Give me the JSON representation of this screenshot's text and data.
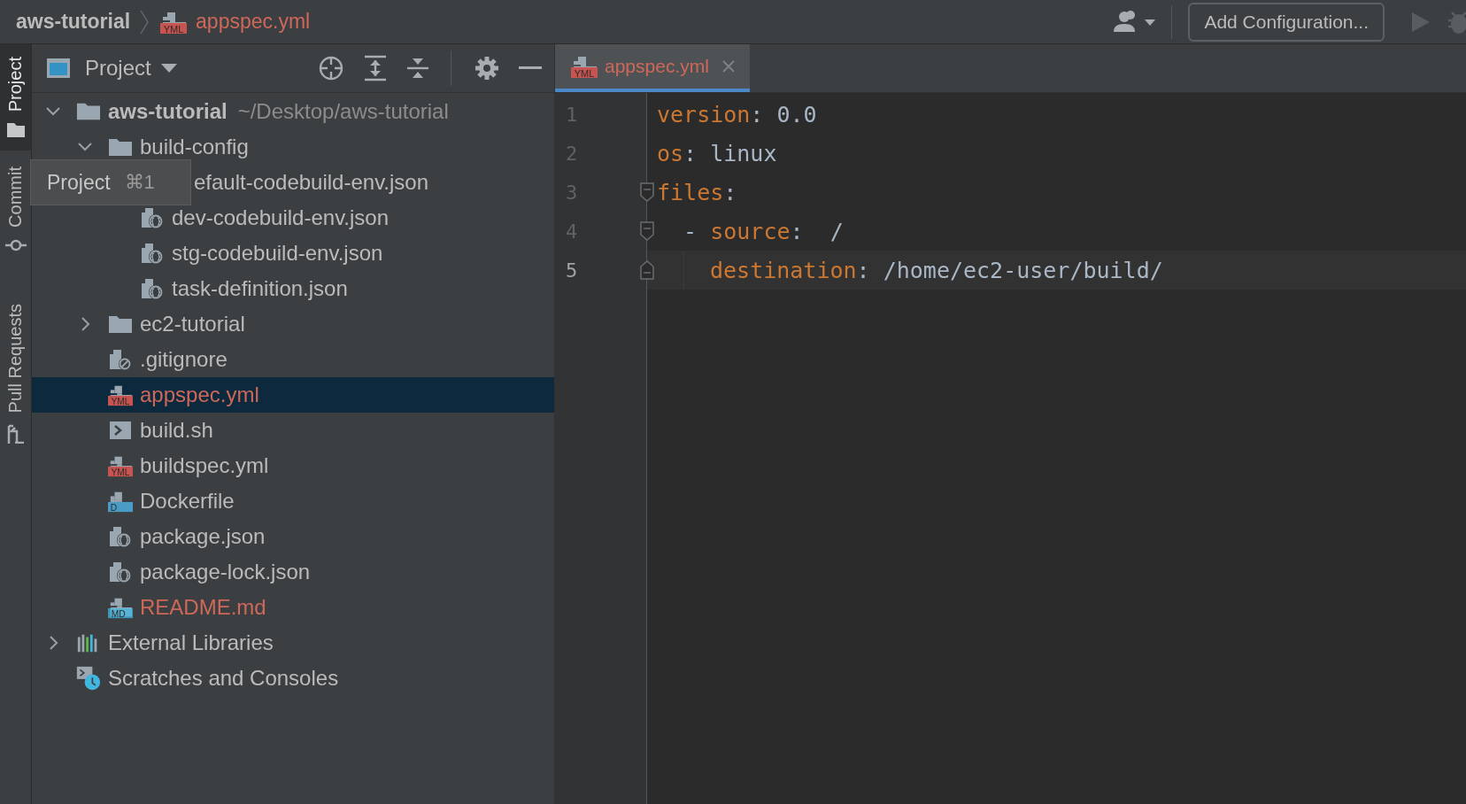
{
  "breadcrumb": [
    {
      "label": "aws-tutorial",
      "kind": "project"
    },
    {
      "label": "appspec.yml",
      "kind": "yml",
      "badge": "YML",
      "color": "#d0685a"
    }
  ],
  "toolbar": {
    "run_config": "Add Configuration..."
  },
  "tool_windows": [
    {
      "label": "Project",
      "kind": "project",
      "selected": true
    },
    {
      "label": "Commit",
      "kind": "commit",
      "selected": false
    },
    {
      "label": "Pull Requests",
      "kind": "pulls",
      "selected": false
    }
  ],
  "project_panel": {
    "title": "Project"
  },
  "tooltip": {
    "text": "Project",
    "shortcut": "⌘1"
  },
  "tree": [
    {
      "label": "aws-tutorial",
      "path": "~/Desktop/aws-tutorial",
      "kind": "module",
      "expanded": true,
      "selected": false,
      "children": [
        {
          "label": "build-config",
          "kind": "folder",
          "expanded": true,
          "selected": false,
          "children": [
            {
              "label": "efault-codebuild-env.json",
              "kind": "covered",
              "selected": false
            },
            {
              "label": "dev-codebuild-env.json",
              "kind": "json",
              "selected": false
            },
            {
              "label": "stg-codebuild-env.json",
              "kind": "json",
              "selected": false
            },
            {
              "label": "task-definition.json",
              "kind": "json",
              "selected": false
            }
          ]
        },
        {
          "label": "ec2-tutorial",
          "kind": "folder",
          "expanded": false,
          "selected": false
        },
        {
          "label": ".gitignore",
          "kind": "ignore",
          "selected": false
        },
        {
          "label": "appspec.yml",
          "kind": "yml",
          "badge": "YML",
          "color": "#d0685a",
          "selected": true
        },
        {
          "label": "build.sh",
          "kind": "shell",
          "selected": false
        },
        {
          "label": "buildspec.yml",
          "kind": "yml",
          "badge": "YML",
          "selected": false
        },
        {
          "label": "Dockerfile",
          "kind": "docker",
          "badge": "D",
          "selected": false
        },
        {
          "label": "package.json",
          "kind": "json",
          "selected": false
        },
        {
          "label": "package-lock.json",
          "kind": "json",
          "selected": false
        },
        {
          "label": "README.md",
          "kind": "md",
          "badge": "MD",
          "color": "#d0685a",
          "selected": false
        }
      ]
    },
    {
      "label": "External Libraries",
      "kind": "libraries",
      "expanded": false,
      "selected": false
    },
    {
      "label": "Scratches and Consoles",
      "kind": "scratches",
      "selected": false
    }
  ],
  "editor": {
    "tabs": [
      {
        "label": "appspec.yml",
        "badge": "YML",
        "selected": true
      }
    ],
    "lines": [
      {
        "number": "1",
        "current": false,
        "kind": "plain",
        "indent_guide": false,
        "tokens": [
          {
            "kind": "key",
            "text": "version"
          },
          {
            "kind": "plain",
            "text": ": 0.0"
          }
        ]
      },
      {
        "number": "2",
        "current": false,
        "kind": "plain",
        "indent_guide": false,
        "tokens": [
          {
            "kind": "key",
            "text": "os"
          },
          {
            "kind": "plain",
            "text": ": linux"
          }
        ]
      },
      {
        "number": "3",
        "current": false,
        "kind": "fold-start",
        "indent_guide": false,
        "tokens": [
          {
            "kind": "key",
            "text": "files"
          },
          {
            "kind": "plain",
            "text": ":"
          }
        ]
      },
      {
        "number": "4",
        "current": false,
        "kind": "fold-start",
        "indent_guide": false,
        "tokens": [
          {
            "kind": "plain",
            "text": "  - "
          },
          {
            "kind": "key",
            "text": "source"
          },
          {
            "kind": "plain",
            "text": ":  /"
          }
        ]
      },
      {
        "number": "5",
        "current": true,
        "kind": "fold-end",
        "indent_guide": true,
        "tokens": [
          {
            "kind": "key",
            "text": "destination"
          },
          {
            "kind": "plain",
            "text": ": /home/ec2-user/build/"
          }
        ]
      }
    ]
  }
}
